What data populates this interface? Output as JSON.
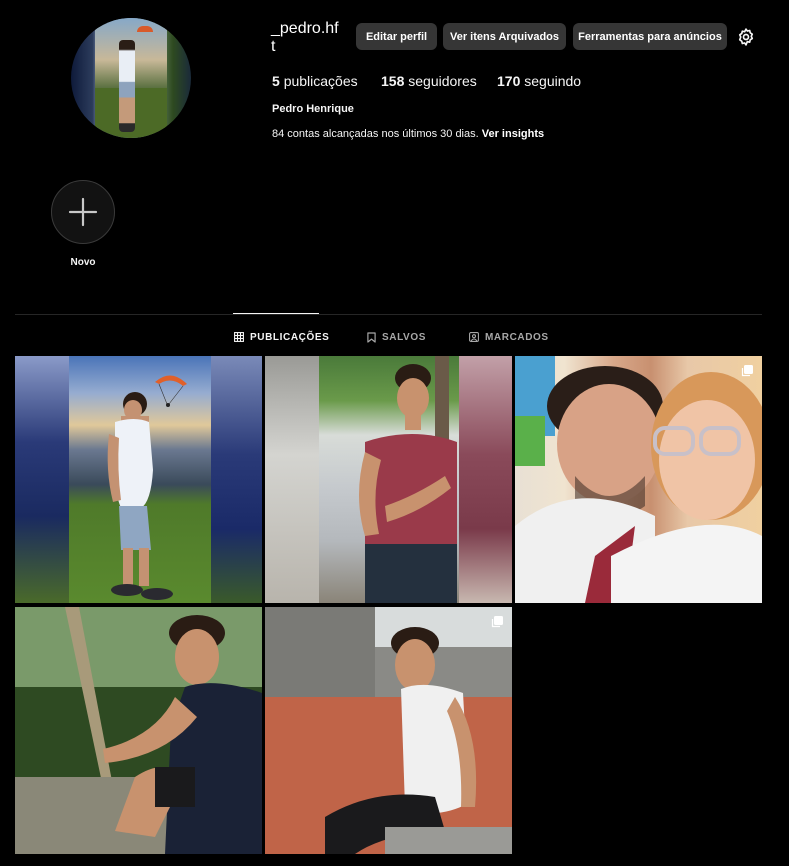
{
  "profile": {
    "username": "_pedro.hft",
    "full_name": "Pedro Henrique",
    "avatar_alt": "foto do perfil",
    "stats": {
      "posts_count": "5",
      "posts_label": "publicações",
      "followers_count": "158",
      "followers_label": "seguidores",
      "following_count": "170",
      "following_label": "seguindo"
    },
    "reach_text": "84 contas alcançadas nos últimos 30 dias.",
    "reach_link": "Ver insights"
  },
  "actions": {
    "edit_profile": "Editar perfil",
    "archived": "Ver itens Arquivados",
    "ad_tools": "Ferramentas para anúncios",
    "settings_icon": "gear-icon"
  },
  "highlights": {
    "new_label": "Novo",
    "new_icon": "plus-icon"
  },
  "tabs": [
    {
      "label": "PUBLICAÇÕES",
      "icon": "grid-icon",
      "active": true
    },
    {
      "label": "SALVOS",
      "icon": "bookmark-icon",
      "active": false
    },
    {
      "label": "MARCADOS",
      "icon": "tagged-icon",
      "active": false
    }
  ],
  "posts": [
    {
      "index": 1,
      "multi": false,
      "scene": "rapaz de camiseta branca em colina ao pôr do sol com parapente"
    },
    {
      "index": 2,
      "multi": false,
      "scene": "rapaz de camiseta vinho sorrindo ao lado de árvore"
    },
    {
      "index": 3,
      "multi": true,
      "scene": "selfie de rapaz com moça de óculos"
    },
    {
      "index": 4,
      "multi": false,
      "scene": "rapaz de regata preta sentado em parque"
    },
    {
      "index": 5,
      "multi": true,
      "scene": "rapaz de regata branca sentado em praça"
    }
  ],
  "colors": {
    "background": "#000000",
    "button_bg": "#363636",
    "divider": "#262626",
    "text_primary": "#f5f5f5",
    "text_secondary": "#a8a8a8"
  }
}
